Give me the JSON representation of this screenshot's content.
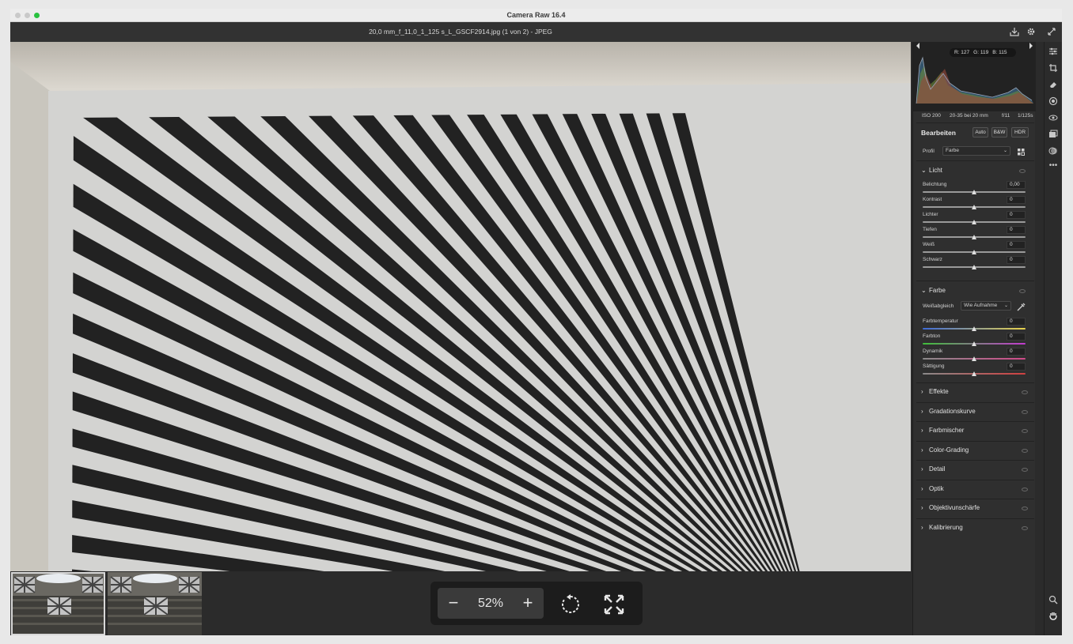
{
  "window": {
    "app_title": "Camera Raw 16.4"
  },
  "file": {
    "title": "20,0 mm_f_11,0_1_125 s_L_GSCF2914.jpg (1 von 2) - JPEG"
  },
  "toolbar_icons": [
    "save-icon",
    "gear-icon",
    "fullscreen-icon"
  ],
  "histogram": {
    "r_label": "R: 127",
    "g_label": "G: 119",
    "b_label": "B: 115"
  },
  "exif": {
    "iso": "ISO 200",
    "lens": "20-35 bei 20 mm",
    "aperture": "f/11",
    "shutter": "1/125s"
  },
  "edit": {
    "title": "Bearbeiten",
    "auto_label": "Auto",
    "bw_label": "B&W",
    "hdr_label": "HDR",
    "profile_label": "Profil",
    "profile_value": "Farbe"
  },
  "light": {
    "title": "Licht",
    "sliders": [
      {
        "name": "Belichtung",
        "value": "0,00",
        "position": 0.5
      },
      {
        "name": "Kontrast",
        "value": "0",
        "position": 0.5
      },
      {
        "name": "Lichter",
        "value": "0",
        "position": 0.5
      },
      {
        "name": "Tiefen",
        "value": "0",
        "position": 0.5
      },
      {
        "name": "Weiß",
        "value": "0",
        "position": 0.5
      },
      {
        "name": "Schwarz",
        "value": "0",
        "position": 0.5
      }
    ]
  },
  "color": {
    "title": "Farbe",
    "wb_label": "Weißabgleich",
    "wb_value": "Wie Aufnahme",
    "sliders": [
      {
        "name": "Farbtemperatur",
        "value": "0",
        "position": 0.5
      },
      {
        "name": "Farbton",
        "value": "0",
        "position": 0.5
      },
      {
        "name": "Dynamik",
        "value": "0",
        "position": 0.5
      },
      {
        "name": "Sättigung",
        "value": "0",
        "position": 0.5
      }
    ]
  },
  "collapsed_sections": [
    "Effekte",
    "Gradationskurve",
    "Farbmischer",
    "Color-Grading",
    "Detail",
    "Optik",
    "Objektivunschärfe",
    "Kalibrierung"
  ],
  "zoom": {
    "minus": "−",
    "value": "52%",
    "plus": "+"
  },
  "colors": {
    "accent_green": "#29c13f",
    "panel_bg": "#2f2f2f",
    "canvas_bg": "#2b2b2b"
  }
}
